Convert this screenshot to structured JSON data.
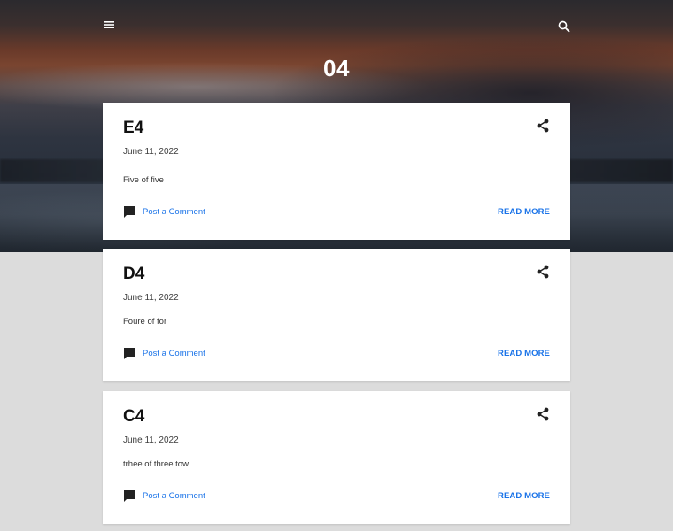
{
  "header": {
    "title": "04",
    "menu_icon": "menu-icon",
    "search_icon": "search-icon"
  },
  "posts": [
    {
      "title": "E4",
      "date": "June 11, 2022",
      "snippet": "Five of five",
      "comment_label": "Post a Comment",
      "read_more_label": "READ MORE"
    },
    {
      "title": "D4",
      "date": "June 11, 2022",
      "snippet": "Foure of for",
      "comment_label": "Post a Comment",
      "read_more_label": "READ MORE"
    },
    {
      "title": "C4",
      "date": "June 11, 2022",
      "snippet": "trhee of three tow",
      "comment_label": "Post a Comment",
      "read_more_label": "READ MORE"
    }
  ],
  "colors": {
    "link": "#1a73e8",
    "page_background": "#dcdcdc",
    "card_background": "#ffffff"
  }
}
